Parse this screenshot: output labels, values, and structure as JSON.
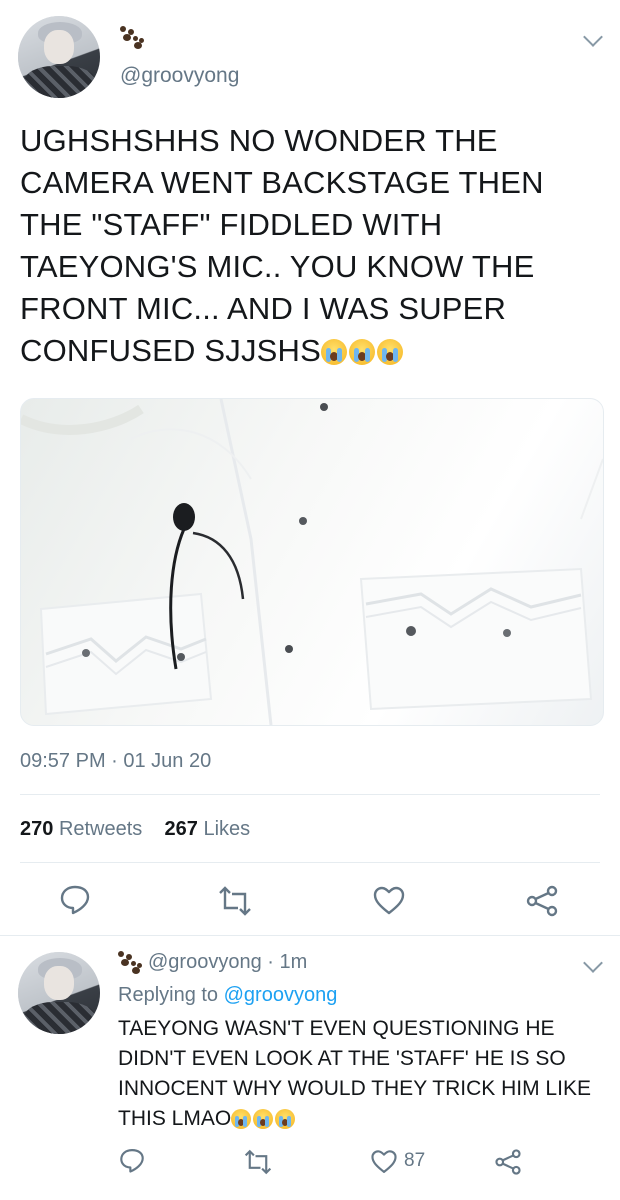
{
  "tweet": {
    "handle": "@groovyong",
    "text": "UGHSHSHHS NO WONDER THE CAMERA WENT BACKSTAGE THEN THE \"STAFF\" FIDDLED WITH TAEYONG'S MIC.. YOU KNOW THE FRONT MIC... AND I WAS SUPER CONFUSED SJJSHS",
    "emojis": [
      "loudly-crying-face",
      "loudly-crying-face",
      "loudly-crying-face"
    ],
    "timestamp": "09:57 PM · 01 Jun 20",
    "retweets_count": "270",
    "retweets_label": "Retweets",
    "likes_count": "267",
    "likes_label": "Likes",
    "actions": [
      "reply-icon",
      "retweet-icon",
      "like-icon",
      "share-icon"
    ]
  },
  "reply": {
    "handle": "@groovyong",
    "time": "· 1m",
    "replying_prefix": "Replying to",
    "replying_to": "@groovyong",
    "text": "TAEYONG WASN'T EVEN QUESTIONING HE DIDN'T EVEN LOOK AT THE 'STAFF' HE IS SO INNOCENT WHY WOULD THEY TRICK HIM LIKE THIS LMAO",
    "emojis": [
      "loudly-crying-face",
      "loudly-crying-face",
      "loudly-crying-face"
    ],
    "like_count": "87",
    "actions": [
      "reply-icon",
      "retweet-icon",
      "like-icon",
      "share-icon"
    ]
  },
  "colors": {
    "accent": "#1da1f2",
    "secondary_text": "#657786",
    "primary_text": "#14171a",
    "divider": "#e6ecf0"
  }
}
